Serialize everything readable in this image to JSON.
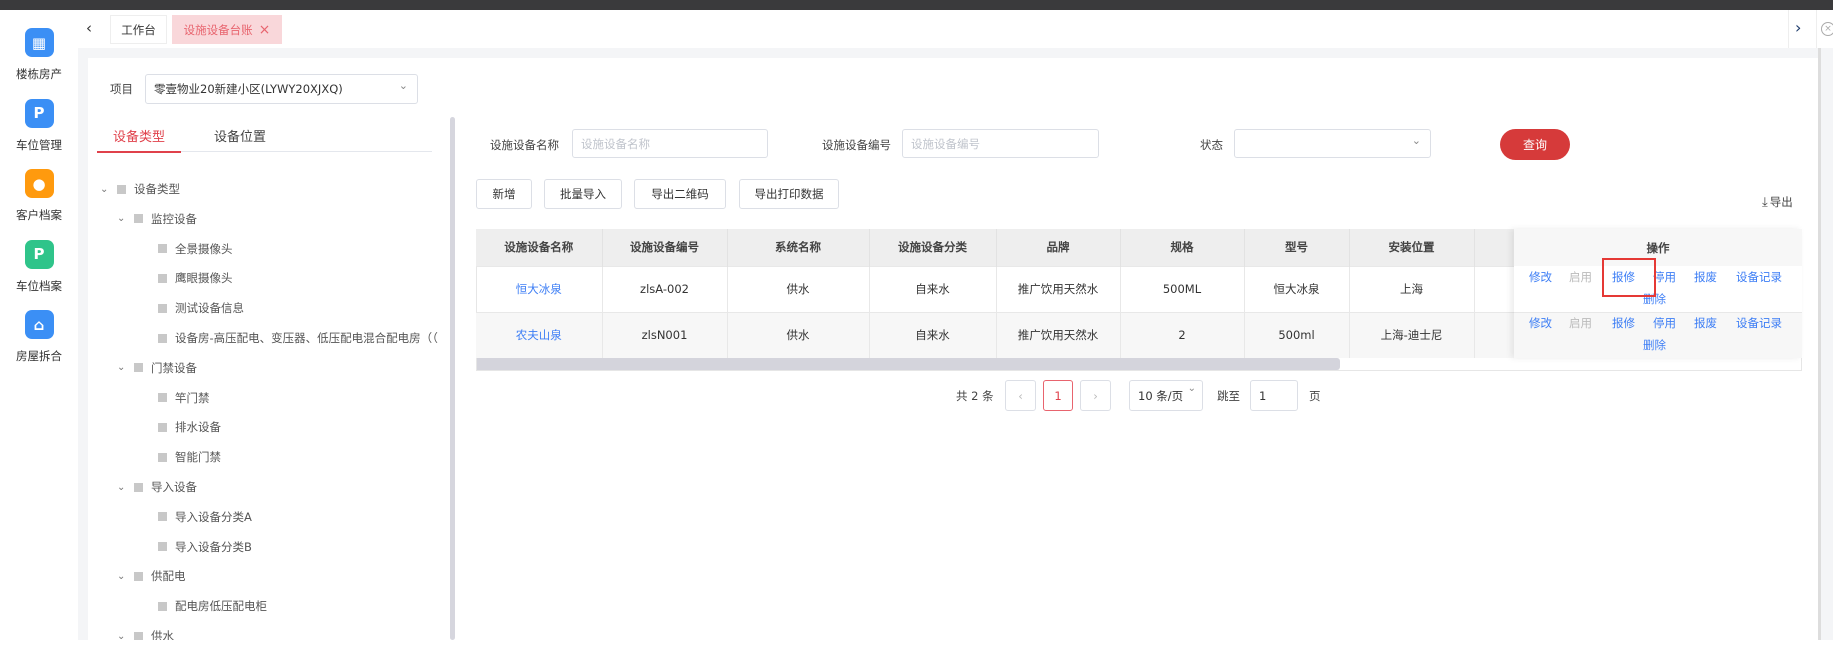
{
  "sidebar": {
    "items": [
      {
        "label": "楼栋房产",
        "icon": "building-icon",
        "color": "#3b8ff5",
        "glyph": "▦"
      },
      {
        "label": "车位管理",
        "icon": "parking-car-icon",
        "color": "#3b8ff5",
        "glyph": "P"
      },
      {
        "label": "客户档案",
        "icon": "user-icon",
        "color": "#ff9a0e",
        "glyph": "●"
      },
      {
        "label": "车位档案",
        "icon": "parking-icon",
        "color": "#2fc48a",
        "glyph": "P"
      },
      {
        "label": "房屋拆合",
        "icon": "home-icon",
        "color": "#3b8ff5",
        "glyph": "⌂"
      }
    ]
  },
  "tabs": {
    "items": [
      {
        "label": "工作台"
      },
      {
        "label": "设施设备台账",
        "close": "×"
      }
    ]
  },
  "project": {
    "label": "项目",
    "value": "零壹物业20新建小区(LYWY20XJXQ)"
  },
  "left_tabs": [
    {
      "label": "设备类型"
    },
    {
      "label": "设备位置"
    }
  ],
  "tree": [
    {
      "label": "设备类型",
      "level": 0,
      "expand": true
    },
    {
      "label": "监控设备",
      "level": 1,
      "expand": true
    },
    {
      "label": "全景摄像头",
      "level": 2
    },
    {
      "label": "鹰眼摄像头",
      "level": 2
    },
    {
      "label": "测试设备信息",
      "level": 2
    },
    {
      "label": "设备房-高压配电、变压器、低压配电混合配电房（（",
      "level": 2
    },
    {
      "label": "门禁设备",
      "level": 1,
      "expand": true
    },
    {
      "label": "竿门禁",
      "level": 2
    },
    {
      "label": "排水设备",
      "level": 2
    },
    {
      "label": "智能门禁",
      "level": 2
    },
    {
      "label": "导入设备",
      "level": 1,
      "expand": true
    },
    {
      "label": "导入设备分类A",
      "level": 2
    },
    {
      "label": "导入设备分类B",
      "level": 2
    },
    {
      "label": "供配电",
      "level": 1,
      "expand": true
    },
    {
      "label": "配电房低压配电柜",
      "level": 2
    },
    {
      "label": "供水",
      "level": 1,
      "expand": true
    }
  ],
  "search": {
    "name_label": "设施设备名称",
    "name_placeholder": "设施设备名称",
    "code_label": "设施设备编号",
    "code_placeholder": "设施设备编号",
    "status_label": "状态",
    "query": "查询"
  },
  "toolbar": {
    "add": "新增",
    "batch_import": "批量导入",
    "export_qr": "导出二维码",
    "export_print": "导出打印数据",
    "export": "导出"
  },
  "table": {
    "headers": [
      "设施设备名称",
      "设施设备编号",
      "系统名称",
      "设施设备分类",
      "品牌",
      "规格",
      "型号",
      "安装位置",
      ""
    ],
    "ops_header": "操作",
    "rows": [
      [
        "恒大冰泉",
        "zlsA-002",
        "供水",
        "自来水",
        "推广饮用天然水",
        "500ML",
        "恒大冰泉",
        "上海",
        ""
      ],
      [
        "农夫山泉",
        "zlsN001",
        "供水",
        "自来水",
        "推广饮用天然水",
        "2",
        "500ml",
        "上海-迪士尼",
        ""
      ]
    ],
    "ops": [
      "修改",
      "启用",
      "报修",
      "停用",
      "报废",
      "设备记录",
      "删除"
    ]
  },
  "pagination": {
    "total": "共 2 条",
    "page": "1",
    "size": "10 条/页",
    "jump": "跳至",
    "jump_value": "1",
    "page_suffix": "页"
  }
}
